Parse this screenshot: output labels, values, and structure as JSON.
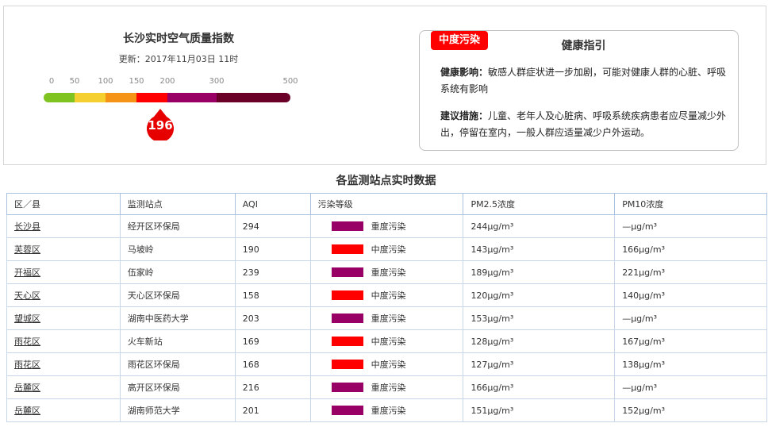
{
  "header": {
    "title": "长沙实时空气质量指数",
    "update": "更新：2017年11月03日 11时"
  },
  "aqi": {
    "value": "196",
    "ticks": [
      "0",
      "50",
      "100",
      "150",
      "200",
      "300",
      "500"
    ],
    "tick_values": [
      0,
      50,
      100,
      150,
      200,
      300,
      500
    ],
    "segment_colors": [
      "#7ec31f",
      "#f5cf30",
      "#f59316",
      "#f00",
      "#990066",
      "#6a0027"
    ],
    "pin_color": "#e60000"
  },
  "guide": {
    "badge": "中度污染",
    "title": "健康指引",
    "impact_label": "健康影响：",
    "impact_text": "敏感人群症状进一步加剧，可能对健康人群的心脏、呼吸系统有影响",
    "advice_label": "建议措施：",
    "advice_text": "儿童、老年人及心脏病、呼吸系统疾病患者应尽量减少外出，停留在室内，一般人群应适量减少户外运动。"
  },
  "stations": {
    "title": "各监测站点实时数据",
    "columns": [
      "区／县",
      "监测站点",
      "AQI",
      "污染等级",
      "PM2.5浓度",
      "PM10浓度"
    ],
    "rows": [
      {
        "district": "长沙县",
        "station": "经开区环保局",
        "aqi": "294",
        "level": "重度污染",
        "color": "#990066",
        "pm25": "244μg/m³",
        "pm10": "—μg/m³"
      },
      {
        "district": "芙蓉区",
        "station": "马坡岭",
        "aqi": "190",
        "level": "中度污染",
        "color": "#ff0000",
        "pm25": "143μg/m³",
        "pm10": "166μg/m³"
      },
      {
        "district": "开福区",
        "station": "伍家岭",
        "aqi": "239",
        "level": "重度污染",
        "color": "#990066",
        "pm25": "189μg/m³",
        "pm10": "221μg/m³"
      },
      {
        "district": "天心区",
        "station": "天心区环保局",
        "aqi": "158",
        "level": "中度污染",
        "color": "#ff0000",
        "pm25": "120μg/m³",
        "pm10": "140μg/m³"
      },
      {
        "district": "望城区",
        "station": "湖南中医药大学",
        "aqi": "203",
        "level": "重度污染",
        "color": "#990066",
        "pm25": "153μg/m³",
        "pm10": "—μg/m³"
      },
      {
        "district": "雨花区",
        "station": "火车新站",
        "aqi": "169",
        "level": "中度污染",
        "color": "#ff0000",
        "pm25": "128μg/m³",
        "pm10": "167μg/m³"
      },
      {
        "district": "雨花区",
        "station": "雨花区环保局",
        "aqi": "168",
        "level": "中度污染",
        "color": "#ff0000",
        "pm25": "127μg/m³",
        "pm10": "138μg/m³"
      },
      {
        "district": "岳麓区",
        "station": "高开区环保局",
        "aqi": "216",
        "level": "重度污染",
        "color": "#990066",
        "pm25": "166μg/m³",
        "pm10": "—μg/m³"
      },
      {
        "district": "岳麓区",
        "station": "湖南师范大学",
        "aqi": "201",
        "level": "重度污染",
        "color": "#990066",
        "pm25": "151μg/m³",
        "pm10": "152μg/m³"
      }
    ]
  }
}
